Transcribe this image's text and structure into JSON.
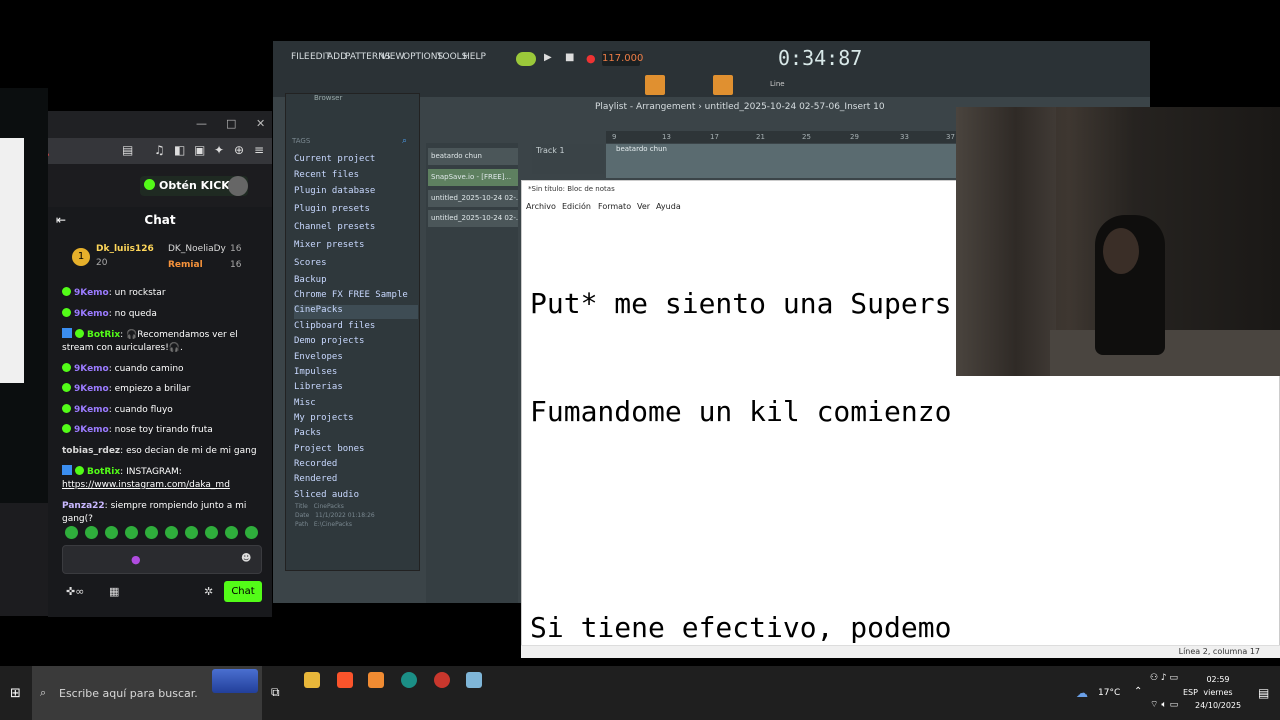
{
  "browser": {
    "chat_title": "Chat",
    "get_kicks": "Obtén KICKs",
    "chat_button": "Chat",
    "leaderboard": [
      {
        "rank": "1",
        "name": "Dk_luiis126",
        "count": "20"
      },
      {
        "name": "DK_NoeliaDy",
        "count": "16"
      },
      {
        "name": "Remial",
        "count": "16"
      }
    ],
    "messages": [
      {
        "user": "9Kemo",
        "text": ": un rockstar"
      },
      {
        "user": "9Kemo",
        "text": ": no queda"
      },
      {
        "user": "BotRix",
        "text": ": 🎧Recomendamos ver el stream con auriculares!🎧."
      },
      {
        "user": "9Kemo",
        "text": ": cuando camino"
      },
      {
        "user": "9Kemo",
        "text": ": empiezo a brillar"
      },
      {
        "user": "9Kemo",
        "text": ": cuando fluyo"
      },
      {
        "user": "9Kemo",
        "text": ": nose toy tirando fruta"
      },
      {
        "user": "tobias_rdez",
        "text": ": eso decian de mi de mi gang"
      },
      {
        "user": "BotRix",
        "text": ": INSTAGRAM:",
        "link": "https://www.instagram.com/daka_md"
      },
      {
        "user": "Panza22",
        "text": ": siempre rompiendo junto a mi gang(?"
      }
    ]
  },
  "fl": {
    "menu": [
      "FILE",
      "EDIT",
      "ADD",
      "PATTERNS",
      "VIEW",
      "OPTIONS",
      "TOOLS",
      "HELP"
    ],
    "tempo": "117.000",
    "time": "0:34:87",
    "browser_label": "Browser",
    "tags_label": "TAGS",
    "browser_items": [
      "Current project",
      "Recent files",
      "Plugin database",
      "Plugin presets",
      "Channel presets",
      "Mixer presets",
      "Scores",
      "Backup",
      "Chrome FX FREE Sample",
      "CinePacks",
      "Clipboard files",
      "Demo projects",
      "Envelopes",
      "Impulses",
      "Librerias",
      "Misc",
      "My projects",
      "Packs",
      "Project bones",
      "Recorded",
      "Rendered",
      "Sliced audio"
    ],
    "meta": {
      "title_label": "Title",
      "title": "CinePacks",
      "date_label": "Date",
      "date": "11/1/2022 01:18:26",
      "path_label": "Path",
      "path": "E:\\CinePacks"
    },
    "patterns": [
      "beatardo chun",
      "SnapSave.io - [FREE]...",
      "untitled_2025-10-24 02-...",
      "untitled_2025-10-24 02-..."
    ],
    "playlist_title": "Playlist - Arrangement › untitled_2025-10-24 02-57-06_Insert 10",
    "track": "Track 1",
    "clip": "beatardo chun",
    "ruler": [
      "9",
      "13",
      "17",
      "21",
      "25",
      "29",
      "33",
      "37"
    ],
    "snap_label": "Line"
  },
  "notepad": {
    "title": "*Sin título: Bloc de notas",
    "menu": [
      "Archivo",
      "Edición",
      "Formato",
      "Ver",
      "Ayuda"
    ],
    "lines": [
      "Put* me siento una Supers",
      "Fumandome un kil comienzo",
      "",
      "Si tiene efectivo, podemo"
    ],
    "status": "Línea 2, columna 17"
  },
  "taskbar": {
    "search_placeholder": "Escribe aquí para buscar.",
    "weather": "17°C",
    "lang": "ESP",
    "time": "02:59",
    "day": "viernes",
    "date": "24/10/2025"
  }
}
